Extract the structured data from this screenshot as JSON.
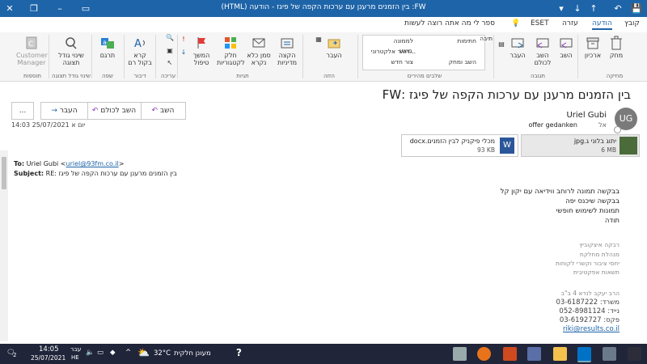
{
  "window": {
    "title": "FW:  בין הזמנים מרענן עם ערכות הקפה של פיגז  -  הודעה (HTML)"
  },
  "tabs": [
    "קובץ",
    "הודעה",
    "עזרה",
    "ESET"
  ],
  "tell_me": "ספר לי מה אתה רוצה לעשות",
  "ribbon": {
    "delete_group": {
      "archive": "ארכיון",
      "delete": "מחק",
      "label": "מחיקה"
    },
    "respond_group": {
      "reply": "השב",
      "reply_all": "השב לכולם",
      "forward": "העבר",
      "label": "תגובה"
    },
    "quick_steps": {
      "items": [
        "תיבה",
        "לממונה",
        "דואר אלקטרוני...",
        "בוצע",
        "השב ומחק",
        "צור חדש",
        "חתימות"
      ],
      "label": "שלבים מהירים"
    },
    "move_group": {
      "move": "העבר",
      "label": "הזזה"
    },
    "tags_group": {
      "assign_policy": "הקצה מדיניות",
      "mark_unread": "סמן כלא נקרא",
      "categorize": "חלק לקטגוריות",
      "followup": "המשך טיפול",
      "label": "תגיות"
    },
    "editing_group": {
      "label": "עריכה"
    },
    "speech_group": {
      "read_aloud": "קרא בקול רם",
      "label": "דיבור"
    },
    "language_group": {
      "translate": "תרגם",
      "label": "שפה"
    },
    "zoom_group": {
      "zoom": "שינוי גודל תצוגה",
      "label": "שינוי גודל תצוגה"
    },
    "addin_group": {
      "customer_manager": "Customer Manager",
      "label": "תוספות"
    }
  },
  "message": {
    "subject": "בין הזמנים מרענן עם ערכות הקפה של פיגז  :FW",
    "actions": {
      "reply": "השב",
      "reply_all": "השב לכולם",
      "forward": "העבר",
      "more": "..."
    },
    "sender_initials": "UG",
    "sender_name": "Uriel Gubi",
    "to_label": "אל",
    "to_value": "offer gedanken",
    "datetime": "יום א 25/07/2021 14:03",
    "attachments": [
      {
        "name": "יתוג בלוני ג.jpg",
        "size": "6 MB"
      },
      {
        "name": "מכלי פיקניק לבין הזמנים.docx",
        "size": "93 KB"
      }
    ],
    "fwd_to_label": "To:",
    "fwd_to_value": "Uriel Gubi <",
    "fwd_to_email": "uriel@93fm.co.il",
    "fwd_to_close": ">",
    "fwd_subject_label": "Subject:",
    "fwd_subject_value": "RE: בין הזמנים מרענן עם ערכות הקפה של פיגז",
    "body_lines": [
      "בבקשה תמונה לרוחב ווידיאה עם יקון קל",
      "בבקשה שיכנס יפה",
      "תמונות לשימוש חופשי",
      "תודה"
    ],
    "signature": [
      "רבקה איצקוביץ",
      "מנהלת מחלקת",
      "יחסי ציבור וקשרי לקוחות",
      "תשאות אפקטיבית"
    ],
    "address": [
      "הרב יעקב לנדא 4 ב\"ב",
      "משרד: 03-6187222",
      "נייד: 052-8981124",
      "פקס: 03-6192727"
    ],
    "email": "riki@results.co.il"
  },
  "taskbar": {
    "time": "14:05",
    "date": "25/07/2021",
    "lang": "עבר",
    "lang2": "HE",
    "weather": "32°C",
    "weather_text": "מעונן חלקית",
    "notif_count": "2"
  }
}
